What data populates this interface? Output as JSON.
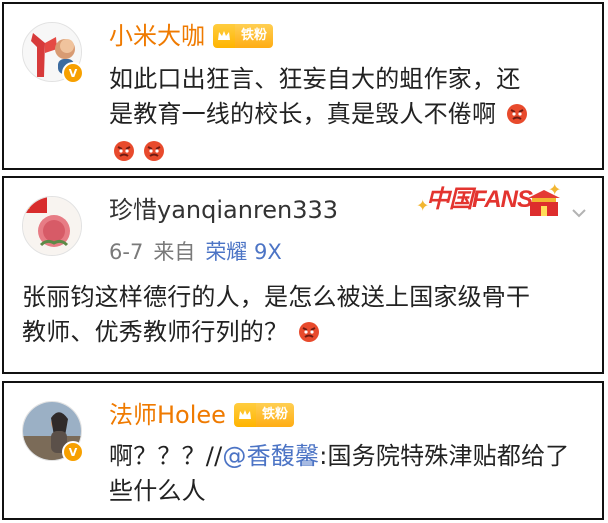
{
  "comments": [
    {
      "username": "小米大咖",
      "badge_label": "铁粉",
      "text_lines": [
        "如此口出狂言、狂妄自大的蛆作家，还",
        "是教育一线的校长，真是毁人不倦啊"
      ]
    },
    {
      "username": "珍惜yanqianren333",
      "date": "6-7",
      "source_prefix": "来自",
      "source_device": "荣耀 9X",
      "fans_banner_text": "中国FANS",
      "text_lines": [
        "张丽钧这样德行的人，是怎么被送上国家级骨干",
        "教师、优秀教师行列的？"
      ]
    },
    {
      "username": "法师Holee",
      "badge_label": "铁粉",
      "text_line1_prefix": "啊？？？//",
      "mention": "@香馥馨",
      "text_line1_suffix": ":国务院特殊津贴都给了",
      "text_line2": "些什么人"
    }
  ],
  "icons": {
    "verified_badge": "v-badge-icon",
    "angry_emoji": "angry-face-icon",
    "dropdown": "chevron-down-icon",
    "crown": "crown-icon"
  },
  "colors": {
    "username_highlight": "#ef7a00",
    "username_normal": "#333333",
    "link": "#4c74c5",
    "badge": "#f7a000",
    "emoji": "#e84a2c"
  }
}
